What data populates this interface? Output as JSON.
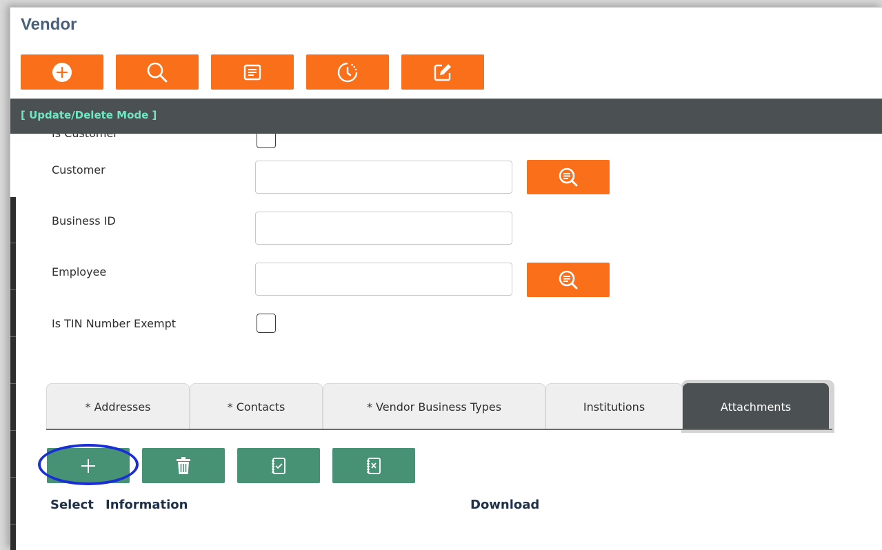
{
  "page": {
    "title": "Vendor",
    "mode": "[ Update/Delete Mode ]"
  },
  "toolbar": {
    "buttons": [
      {
        "name": "add-button",
        "icon": "plus-circle-icon"
      },
      {
        "name": "search-button",
        "icon": "magnifier-icon"
      },
      {
        "name": "list-button",
        "icon": "list-icon"
      },
      {
        "name": "history-button",
        "icon": "clock-icon"
      },
      {
        "name": "edit-button",
        "icon": "edit-icon"
      }
    ]
  },
  "form": {
    "is_customer_label": "Is Customer",
    "customer_label": "Customer",
    "customer_value": "",
    "business_id_label": "Business ID",
    "business_id_value": "",
    "employee_label": "Employee",
    "employee_value": "",
    "tin_exempt_label": "Is TIN Number Exempt",
    "lookup_icon": "search-list-icon"
  },
  "tabs": [
    {
      "label": "* Addresses",
      "active": false
    },
    {
      "label": "* Contacts",
      "active": false
    },
    {
      "label": "* Vendor Business Types",
      "active": false
    },
    {
      "label": "Institutions",
      "active": false
    },
    {
      "label": "Attachments",
      "active": true
    }
  ],
  "attachments": {
    "actions": [
      {
        "name": "add-attachment-button",
        "icon": "plus-icon"
      },
      {
        "name": "delete-attachment-button",
        "icon": "trash-icon"
      },
      {
        "name": "select-all-button",
        "icon": "notebook-check-icon"
      },
      {
        "name": "deselect-all-button",
        "icon": "notebook-x-icon"
      }
    ],
    "columns": [
      "Select",
      "Information",
      "Download"
    ]
  },
  "colors": {
    "accent_orange": "#fa6f1a",
    "accent_green": "#479174",
    "mode_bar": "#4b5153",
    "mode_text": "#6ee8c0",
    "title": "#4a6078",
    "highlight": "#1a2ed6"
  }
}
